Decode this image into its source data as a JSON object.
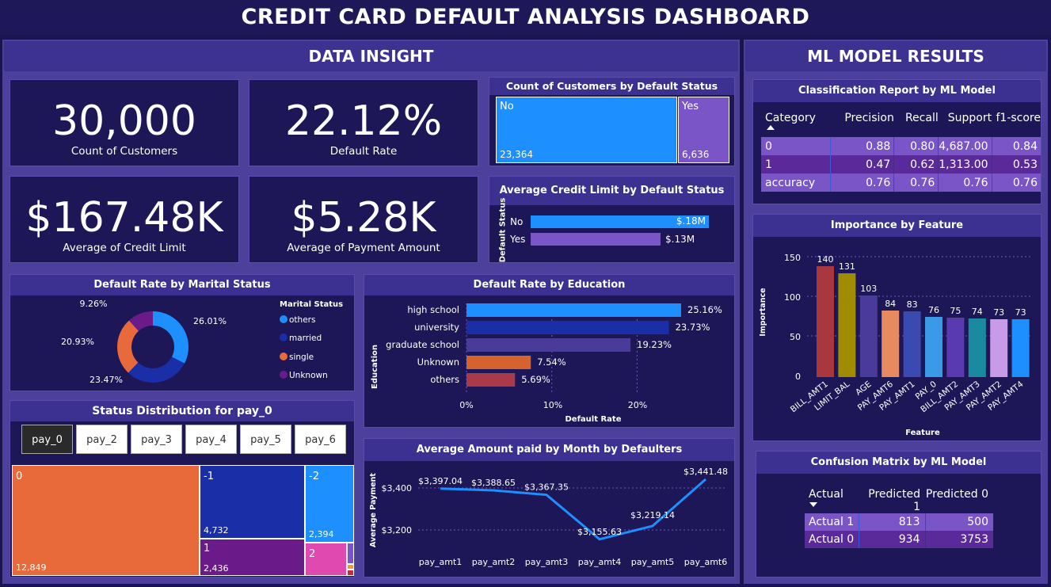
{
  "title": "CREDIT CARD DEFAULT ANALYSIS DASHBOARD",
  "sections": {
    "left": "DATA INSIGHT",
    "right": "ML MODEL RESULTS"
  },
  "kpis": [
    {
      "value": "30,000",
      "label": "Count of Customers"
    },
    {
      "value": "22.12%",
      "label": "Default Rate"
    },
    {
      "value": "$167.48K",
      "label": "Average of Credit Limit"
    },
    {
      "value": "$5.28K",
      "label": "Average of Payment Amount"
    }
  ],
  "count_by_status": {
    "title": "Count of Customers by Default Status",
    "items": [
      {
        "label": "No",
        "value": "23,364"
      },
      {
        "label": "Yes",
        "value": "6,636"
      }
    ]
  },
  "avg_credit": {
    "title": "Average Credit Limit by Default Status",
    "axis": "Default Status",
    "items": [
      {
        "label": "No",
        "value": "$.18M"
      },
      {
        "label": "Yes",
        "value": "$.13M"
      }
    ]
  },
  "marital": {
    "title": "Default Rate by Marital Status",
    "legend_title": "Marital Status",
    "items": [
      {
        "label": "others",
        "pct": "26.01%",
        "color": "#1e8fff"
      },
      {
        "label": "married",
        "pct": "23.47%",
        "color": "#1a2ea8"
      },
      {
        "label": "single",
        "pct": "20.93%",
        "color": "#e8693a"
      },
      {
        "label": "Unknown",
        "pct": "9.26%",
        "color": "#6b1a8a"
      }
    ]
  },
  "education": {
    "title": "Default Rate by Education",
    "ylabel": "Education",
    "xlabel": "Default Rate",
    "ticks": [
      "0%",
      "10%",
      "20%"
    ]
  },
  "pay_status": {
    "title": "Status Distribution for pay_0",
    "tabs": [
      "pay_0",
      "pay_2",
      "pay_3",
      "pay_4",
      "pay_5",
      "pay_6"
    ],
    "tiles": [
      {
        "label": "0",
        "value": "12,849"
      },
      {
        "label": "-1",
        "value": "4,732"
      },
      {
        "label": "-2",
        "value": "2,394"
      },
      {
        "label": "1",
        "value": "2,436"
      },
      {
        "label": "2",
        "value": ""
      }
    ]
  },
  "amount_paid": {
    "title": "Average Amount paid by Month by Defaulters",
    "ylabel": "Average Payment",
    "yticks": [
      "$3,400",
      "$3,200"
    ]
  },
  "classification": {
    "title": "Classification Report by ML Model",
    "headers": [
      "Category",
      "Precision",
      "Recall",
      "Support",
      "f1-score"
    ],
    "rows": [
      [
        "0",
        "0.88",
        "0.80",
        "4,687.00",
        "0.84"
      ],
      [
        "1",
        "0.47",
        "0.62",
        "1,313.00",
        "0.53"
      ],
      [
        "accuracy",
        "0.76",
        "0.76",
        "0.76",
        "0.76"
      ]
    ]
  },
  "importance": {
    "title": "Importance by Feature",
    "ylabel": "Importance",
    "xlabel": "Feature",
    "yticks": [
      "150",
      "100",
      "50",
      "0"
    ]
  },
  "confusion": {
    "title": "Confusion Matrix by ML Model",
    "headers": [
      "Actual",
      "Predicted 1",
      "Predicted 0"
    ],
    "rows": [
      [
        "Actual 1",
        "813",
        "500"
      ],
      [
        "Actual 0",
        "934",
        "3753"
      ]
    ]
  },
  "chart_data": [
    {
      "type": "bar",
      "title": "Default Rate by Education",
      "categories": [
        "high school",
        "university",
        "graduate school",
        "Unknown",
        "others"
      ],
      "values": [
        25.16,
        23.73,
        19.23,
        7.54,
        5.69
      ],
      "labels": [
        "25.16%",
        "23.73%",
        "19.23%",
        "7.54%",
        "5.69%"
      ],
      "colors": [
        "#1e8fff",
        "#1a2ea8",
        "#4a3a9a",
        "#d4632f",
        "#a83a4a"
      ],
      "xlabel": "Default Rate",
      "ylabel": "Education",
      "xlim": [
        0,
        25.16
      ]
    },
    {
      "type": "line",
      "title": "Average Amount paid by Month by Defaulters",
      "x": [
        "pay_amt1",
        "pay_amt2",
        "pay_amt3",
        "pay_amt4",
        "pay_amt5",
        "pay_amt6"
      ],
      "values": [
        3397.04,
        3388.65,
        3367.35,
        3155.63,
        3219.14,
        3441.48
      ],
      "labels": [
        "$3,397.04",
        "$3,388.65",
        "$3,367.35",
        "$3,155.63",
        "$3,219.14",
        "$3,441.48"
      ],
      "ylabel": "Average Payment"
    },
    {
      "type": "bar",
      "title": "Importance by Feature",
      "categories": [
        "BILL_AMT1",
        "LIMIT_BAL",
        "AGE",
        "PAY_AMT6",
        "PAY_AMT1",
        "PAY_0",
        "BILL_AMT2",
        "PAY_AMT3",
        "PAY_AMT2",
        "PAY_AMT4"
      ],
      "values": [
        140,
        131,
        103,
        84,
        83,
        76,
        75,
        74,
        73,
        73
      ],
      "colors": [
        "#a8383e",
        "#a08c00",
        "#4a3a9a",
        "#e88a60",
        "#3a4ab0",
        "#3a9ae8",
        "#5a3ab0",
        "#1a8aa0",
        "#c89ae8",
        "#1e8fff"
      ],
      "xlabel": "Feature",
      "ylabel": "Importance",
      "ylim": [
        0,
        150
      ]
    },
    {
      "type": "pie",
      "title": "Default Rate by Marital Status",
      "categories": [
        "others",
        "married",
        "single",
        "Unknown"
      ],
      "values": [
        26.01,
        23.47,
        20.93,
        9.26
      ]
    }
  ]
}
